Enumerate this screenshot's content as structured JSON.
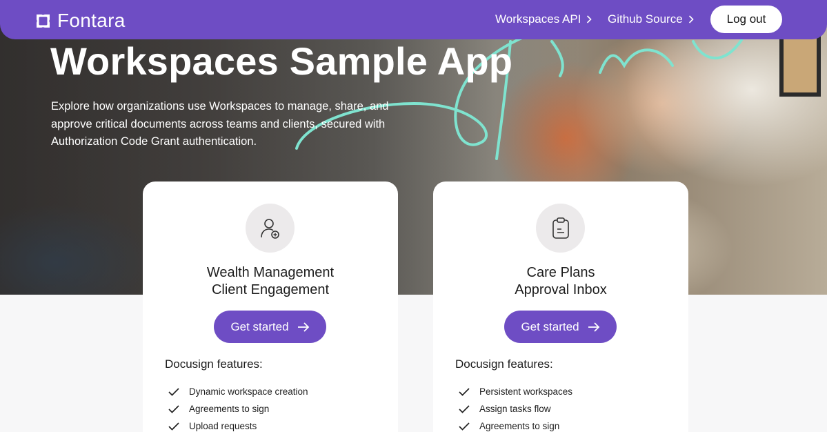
{
  "header": {
    "logo_text": "Fontara",
    "nav": [
      {
        "label": "Workspaces API"
      },
      {
        "label": "Github Source"
      }
    ],
    "logout_label": "Log out"
  },
  "hero": {
    "title": "Workspaces Sample App",
    "intro": "Explore how organizations use Workspaces to manage, share, and approve critical documents across teams and clients, secured with Authorization Code Grant authentication."
  },
  "cards": [
    {
      "icon": "user-plus-icon",
      "title_line1": "Wealth Management",
      "title_line2": "Client Engagement",
      "button_label": "Get started",
      "features_heading": "Docusign features:",
      "features": [
        "Dynamic workspace creation",
        "Agreements to sign",
        "Upload requests"
      ]
    },
    {
      "icon": "clipboard-icon",
      "title_line1": "Care Plans",
      "title_line2": "Approval Inbox",
      "button_label": "Get started",
      "features_heading": "Docusign features:",
      "features": [
        "Persistent workspaces",
        "Assign tasks flow",
        "Agreements to sign"
      ]
    }
  ],
  "colors": {
    "brand": "#6e4dc4",
    "accent_squiggle": "#7fe3cf",
    "card_bg": "#ffffff",
    "page_bg": "#f7f7f8"
  }
}
